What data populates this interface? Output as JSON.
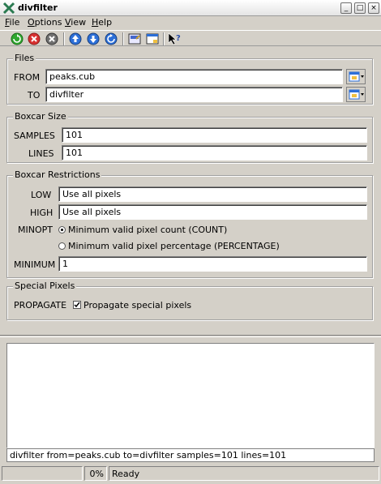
{
  "window": {
    "title": "divfilter"
  },
  "window_buttons": {
    "minimize": "_",
    "maximize": "□",
    "close": "×"
  },
  "menu": [
    {
      "label": "File",
      "u": "F",
      "rest": "ile"
    },
    {
      "label": "Options",
      "u": "O",
      "rest": "ptions"
    },
    {
      "label": "View",
      "u": "V",
      "rest": "iew"
    },
    {
      "label": "Help",
      "u": "H",
      "rest": "elp"
    }
  ],
  "toolbar_icons": [
    "run-icon",
    "stop-icon",
    "exit-icon",
    "up-icon",
    "down-icon",
    "reset-icon",
    "save-icon",
    "window-icon",
    "help-pointer-icon"
  ],
  "files": {
    "title": "Files",
    "from_label": "FROM",
    "from_value": "peaks.cub",
    "to_label": "TO",
    "to_value": "divfilter"
  },
  "boxcar_size": {
    "title": "Boxcar Size",
    "samples_label": "SAMPLES",
    "samples_value": "101",
    "lines_label": "LINES",
    "lines_value": "101"
  },
  "boxcar_restrictions": {
    "title": "Boxcar Restrictions",
    "low_label": "LOW",
    "low_value": "Use all pixels",
    "high_label": "HIGH",
    "high_value": "Use all pixels",
    "minopt_label": "MINOPT",
    "minopt_options": [
      "Minimum valid pixel count (COUNT)",
      "Minimum valid pixel percentage (PERCENTAGE)"
    ],
    "minopt_selected": 0,
    "minimum_label": "MINIMUM",
    "minimum_value": "1"
  },
  "special_pixels": {
    "title": "Special Pixels",
    "propagate_label": "PROPAGATE",
    "propagate_checkbox_label": "Propagate special pixels",
    "propagate_checked": true
  },
  "command_line": "divfilter from=peaks.cub to=divfilter samples=101 lines=101",
  "status": {
    "progress": "0%",
    "message": "Ready"
  },
  "colors": {
    "green": "#2fa82f",
    "red": "#d83030",
    "blue": "#2c6fd8",
    "gray": "#707070"
  }
}
